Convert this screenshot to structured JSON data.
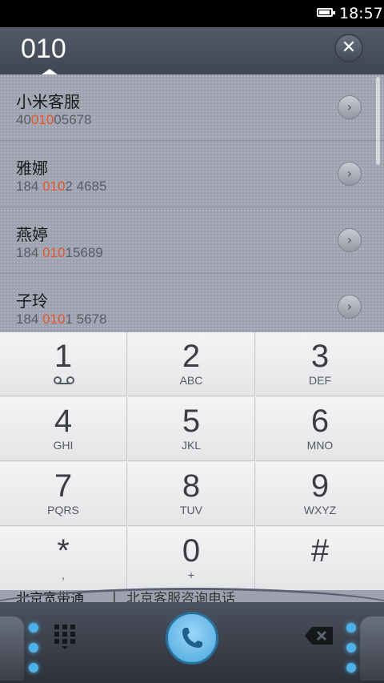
{
  "status_bar": {
    "time": "18:57",
    "battery_level": 0.9
  },
  "dial_input": {
    "value": "010"
  },
  "results": [
    {
      "name": "小米客服",
      "num_pre": "40",
      "num_hl": "010",
      "num_post": "05678"
    },
    {
      "name": "雅娜",
      "num_pre": "184 ",
      "num_hl": "010",
      "num_post": "2 4685"
    },
    {
      "name": "燕婷",
      "num_pre": "184 ",
      "num_hl": "010",
      "num_post": "15689"
    },
    {
      "name": "子玲",
      "num_pre": "184 ",
      "num_hl": "010",
      "num_post": "1 5678"
    }
  ],
  "peek_row": {
    "name": "北京宽带通",
    "detail": "北京客服咨询电话"
  },
  "dialpad": {
    "keys": [
      {
        "digit": "1",
        "letters": ""
      },
      {
        "digit": "2",
        "letters": "ABC"
      },
      {
        "digit": "3",
        "letters": "DEF"
      },
      {
        "digit": "4",
        "letters": "GHI"
      },
      {
        "digit": "5",
        "letters": "JKL"
      },
      {
        "digit": "6",
        "letters": "MNO"
      },
      {
        "digit": "7",
        "letters": "PQRS"
      },
      {
        "digit": "8",
        "letters": "TUV"
      },
      {
        "digit": "9",
        "letters": "WXYZ"
      },
      {
        "digit": "*",
        "letters": ","
      },
      {
        "digit": "0",
        "letters": "+"
      },
      {
        "digit": "#",
        "letters": ""
      }
    ]
  },
  "icons": {
    "clear": "close-icon",
    "row_action": "chevron-right-icon",
    "voicemail": "voicemail-icon",
    "keypad_toggle": "keypad-grid-icon",
    "call": "phone-icon",
    "delete": "backspace-icon"
  },
  "colors": {
    "highlight": "#e6562b",
    "accent": "#4fb1e8"
  }
}
